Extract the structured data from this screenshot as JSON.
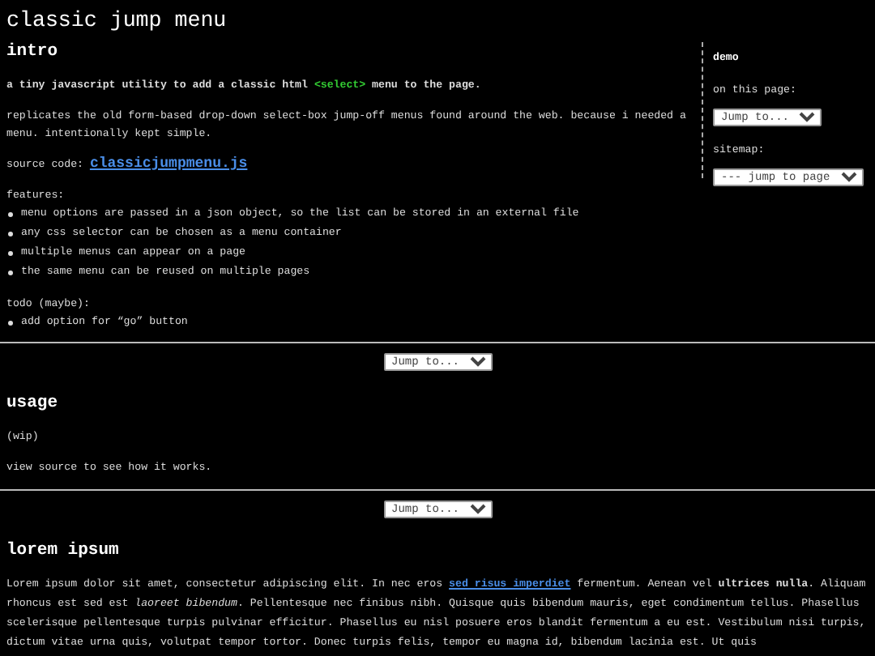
{
  "title": "classic jump menu",
  "intro": {
    "heading": "intro",
    "lead": [
      {
        "kind": "text",
        "text": "a tiny javascript utility to add a classic html "
      },
      {
        "kind": "code",
        "text": "<select>"
      },
      {
        "kind": "text",
        "text": " menu to the page."
      }
    ],
    "description": "replicates the old form-based drop-down select-box jump-off menus found around the web. because i needed a menu. intentionally kept simple.",
    "source": {
      "label": "source code:",
      "link": "classicjumpmenu.js"
    },
    "features_label": "features:",
    "features": [
      "menu options are passed in a json object, so the list can be stored in an external file",
      "any css selector can be chosen as a menu container",
      "multiple menus can appear on a page",
      "the same menu can be reused on multiple pages"
    ],
    "todo_label": "todo (maybe):",
    "todo": [
      "add option for “go” button"
    ]
  },
  "sidebar": {
    "heading": "demo",
    "menus": [
      {
        "label": "on this page:",
        "value": "Jump to..."
      },
      {
        "label": "sitemap:",
        "value": "--- jump to page"
      }
    ]
  },
  "section_menus": [
    "Jump to...",
    "Jump to..."
  ],
  "usage": {
    "heading": "usage",
    "paragraphs": [
      "(wip)",
      "view source to see how it works."
    ]
  },
  "lorem": {
    "heading": "lorem ipsum",
    "parts": [
      {
        "kind": "text",
        "text": "Lorem ipsum dolor sit amet, consectetur adipiscing elit. In nec eros "
      },
      {
        "kind": "link",
        "text": "sed risus imperdiet"
      },
      {
        "kind": "text",
        "text": " fermentum. Aenean vel **ultrices nulla**. Aliquam rhoncus est sed est *laoreet bibendum*. Pellentesque nec finibus nibh. Quisque quis bibendum mauris, eget condimentum tellus. Phasellus scelerisque pellentesque turpis pulvinar efficitur. Phasellus eu nisl posuere eros blandit fermentum a eu est. Vestibulum nisi turpis, dictum vitae urna quis, volutpat tempor tortor. Donec turpis felis, tempor eu magna id, bibendum lacinia est. Ut quis"
      }
    ]
  }
}
